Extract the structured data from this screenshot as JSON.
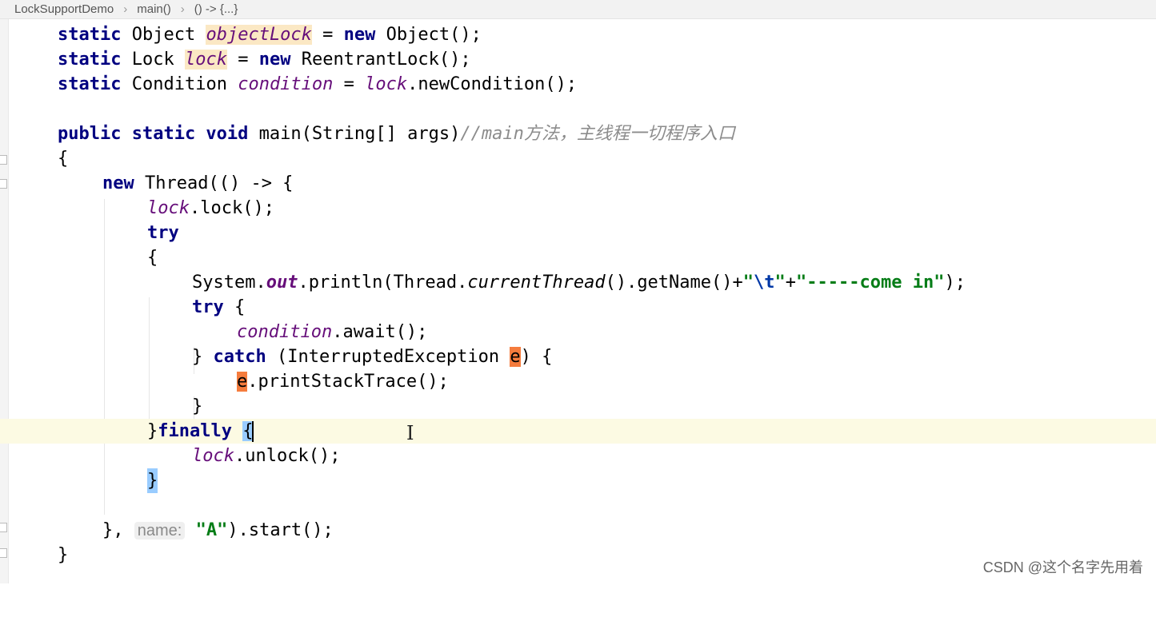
{
  "breadcrumb": {
    "items": [
      "LockSupportDemo",
      "main()",
      "() -> {...}"
    ],
    "separator": "›"
  },
  "code": {
    "line1": {
      "kw": "static",
      "type": "Object",
      "name": "objectLock",
      "op": "=",
      "kw2": "new",
      "rest": "Object();"
    },
    "line2": {
      "kw": "static",
      "type": "Lock",
      "name": "lock",
      "op": "=",
      "kw2": "new",
      "rest": "ReentrantLock();"
    },
    "line3": {
      "kw": "static",
      "type": "Condition",
      "name": "condition",
      "op": "=",
      "ref": "lock",
      "rest": ".newCondition();"
    },
    "line5": {
      "kw": "public static void",
      "sig": "main(String[] args)",
      "comment": "//main方法，主线程一切程序入口"
    },
    "line6": "{",
    "line7": {
      "kw": "new",
      "rest": "Thread(() -> {"
    },
    "line8": {
      "ref": "lock",
      "rest": ".lock();"
    },
    "line9": "try",
    "line10": "{",
    "line11": {
      "a": "System.",
      "out": "out",
      "b": ".println(Thread.",
      "cur": "currentThread",
      "c": "().getName()+",
      "q1": "\"",
      "esc": "\\t",
      "q2": "\"",
      "plus": "+",
      "str": "\"-----come in\"",
      "end": ");"
    },
    "line12": {
      "kw": "try",
      "rest": " {"
    },
    "line13": {
      "ref": "condition",
      "rest": ".await();"
    },
    "line14": {
      "a": "} ",
      "kw": "catch",
      "b": " (InterruptedException ",
      "param": "e",
      "c": ") {"
    },
    "line15": {
      "param": "e",
      "rest": ".printStackTrace();"
    },
    "line16": "}",
    "line17": {
      "a": "}",
      "kw": "finally",
      "sp": " ",
      "brace": "{"
    },
    "line18": {
      "ref": "lock",
      "rest": ".unlock();"
    },
    "line19": "}",
    "line21": {
      "a": "},",
      "hint": "name:",
      "str": "\"A\"",
      "rest": ").start();"
    },
    "line22": "}"
  },
  "watermark": "CSDN @这个名字先用着"
}
